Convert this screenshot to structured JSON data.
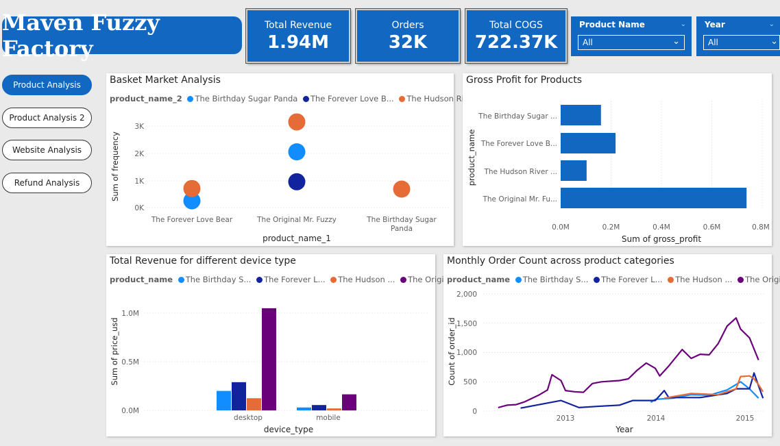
{
  "header": {
    "title": "Maven Fuzzy Factory"
  },
  "kpis": [
    {
      "label": "Total Revenue",
      "value": "1.94M"
    },
    {
      "label": "Orders",
      "value": "32K"
    },
    {
      "label": "Total COGS",
      "value": "722.37K"
    }
  ],
  "slicers": [
    {
      "label": "Product Name",
      "value": "All"
    },
    {
      "label": "Year",
      "value": "All"
    }
  ],
  "nav": [
    "Product Analysis",
    "Product Analysis 2",
    "Website Analysis",
    "Refund Analysis"
  ],
  "colors": {
    "blue_light": "#118dff",
    "blue_dark": "#12239e",
    "orange": "#e66c37",
    "purple": "#6b007b",
    "brand": "#1267c1"
  },
  "charts": {
    "basket": {
      "title": "Basket Market Analysis",
      "legend_title": "product_name_2",
      "legend": [
        "The Birthday Sugar Panda",
        "The Forever Love B...",
        "The Hudson River ..."
      ],
      "xlabel": "product_name_1",
      "ylabel": "Sum of frequency",
      "yticks": [
        "0K",
        "1K",
        "2K",
        "3K"
      ],
      "xcats": [
        "The Forever Love Bear",
        "The Original Mr. Fuzzy",
        "The Birthday Sugar Panda"
      ]
    },
    "gross": {
      "title": "Gross Profit for Products",
      "ylabel": "product_name",
      "xlabel": "Sum of gross_profit",
      "cats": [
        "The Birthday Sugar ...",
        "The Forever Love B...",
        "The Hudson River ...",
        "The Original Mr. Fu..."
      ],
      "xticks": [
        "0.0M",
        "0.2M",
        "0.4M",
        "0.6M",
        "0.8M"
      ]
    },
    "device": {
      "title": "Total Revenue for different device type",
      "legend_title": "product_name",
      "legend": [
        "The Birthday S...",
        "The Forever L...",
        "The Hudson ...",
        "The Origin..."
      ],
      "ylabel": "Sum of price_usd",
      "xlabel": "device_type",
      "yticks": [
        "0.0M",
        "0.5M",
        "1.0M"
      ],
      "cats": [
        "desktop",
        "mobile"
      ]
    },
    "monthly": {
      "title": "Monthly Order Count across product categories",
      "legend_title": "product_name",
      "legend": [
        "The Birthday S...",
        "The Forever L...",
        "The Hudson ...",
        "The Origi..."
      ],
      "ylabel": "Count of order_id",
      "xlabel": "Year",
      "yticks": [
        "0",
        "500",
        "1,000",
        "1,500",
        "2,000"
      ],
      "xticks": [
        "2013",
        "2014",
        "2015"
      ]
    }
  },
  "chart_data": [
    {
      "type": "scatter",
      "title": "Basket Market Analysis",
      "xlabel": "product_name_1",
      "ylabel": "Sum of frequency",
      "categories": [
        "The Forever Love Bear",
        "The Original Mr. Fuzzy",
        "The Birthday Sugar Panda"
      ],
      "ylim": [
        0,
        3500
      ],
      "series": [
        {
          "name": "The Birthday Sugar Panda",
          "values": [
            250,
            2050,
            null
          ]
        },
        {
          "name": "The Forever Love B...",
          "values": [
            null,
            950,
            null
          ]
        },
        {
          "name": "The Hudson River ...",
          "values": [
            700,
            3150,
            680
          ]
        }
      ]
    },
    {
      "type": "bar",
      "title": "Gross Profit for Products",
      "xlabel": "Sum of gross_profit",
      "ylabel": "product_name",
      "categories": [
        "The Birthday Sugar ...",
        "The Forever Love B...",
        "The Hudson River ...",
        "The Original Mr. Fu..."
      ],
      "values": [
        160000,
        218000,
        103000,
        738000
      ],
      "xlim": [
        0,
        800000
      ]
    },
    {
      "type": "bar",
      "title": "Total Revenue for different device type",
      "xlabel": "device_type",
      "ylabel": "Sum of price_usd",
      "categories": [
        "desktop",
        "mobile"
      ],
      "ylim": [
        0,
        1200000
      ],
      "series": [
        {
          "name": "The Birthday S...",
          "values": [
            200000,
            30000
          ]
        },
        {
          "name": "The Forever L...",
          "values": [
            290000,
            55000
          ]
        },
        {
          "name": "The Hudson ...",
          "values": [
            125000,
            20000
          ]
        },
        {
          "name": "The Origin...",
          "values": [
            1050000,
            165000
          ]
        }
      ]
    },
    {
      "type": "line",
      "title": "Monthly Order Count across product categories",
      "xlabel": "Year",
      "ylabel": "Count of order_id",
      "ylim": [
        0,
        2000
      ],
      "series": [
        {
          "name": "The Birthday S...",
          "points": [
            [
              2013.95,
              150
            ],
            [
              2014.0,
              200
            ],
            [
              2014.2,
              220
            ],
            [
              2014.4,
              280
            ],
            [
              2014.6,
              270
            ],
            [
              2014.8,
              360
            ],
            [
              2014.95,
              500
            ],
            [
              2015.05,
              380
            ],
            [
              2015.15,
              220
            ]
          ]
        },
        {
          "name": "The Forever L...",
          "points": [
            [
              2012.5,
              50
            ],
            [
              2012.95,
              180
            ],
            [
              2013.15,
              60
            ],
            [
              2013.35,
              80
            ],
            [
              2013.6,
              100
            ],
            [
              2013.75,
              180
            ],
            [
              2014.0,
              180
            ],
            [
              2014.1,
              350
            ],
            [
              2014.15,
              230
            ],
            [
              2014.5,
              230
            ],
            [
              2014.8,
              300
            ],
            [
              2014.9,
              380
            ],
            [
              2015.05,
              380
            ],
            [
              2015.1,
              650
            ],
            [
              2015.15,
              430
            ],
            [
              2015.2,
              220
            ]
          ]
        },
        {
          "name": "The Hudson ...",
          "points": [
            [
              2014.1,
              220
            ],
            [
              2014.4,
              300
            ],
            [
              2014.7,
              280
            ],
            [
              2014.9,
              380
            ],
            [
              2014.95,
              590
            ],
            [
              2015.05,
              600
            ],
            [
              2015.1,
              550
            ],
            [
              2015.15,
              450
            ],
            [
              2015.2,
              330
            ]
          ]
        },
        {
          "name": "The Origi...",
          "points": [
            [
              2012.25,
              60
            ],
            [
              2012.35,
              100
            ],
            [
              2012.45,
              110
            ],
            [
              2012.55,
              160
            ],
            [
              2012.7,
              270
            ],
            [
              2012.8,
              360
            ],
            [
              2012.85,
              620
            ],
            [
              2012.95,
              520
            ],
            [
              2013.0,
              350
            ],
            [
              2013.1,
              330
            ],
            [
              2013.2,
              320
            ],
            [
              2013.3,
              470
            ],
            [
              2013.4,
              500
            ],
            [
              2013.5,
              510
            ],
            [
              2013.6,
              520
            ],
            [
              2013.7,
              550
            ],
            [
              2013.8,
              700
            ],
            [
              2013.9,
              820
            ],
            [
              2014.0,
              730
            ],
            [
              2014.05,
              600
            ],
            [
              2014.15,
              770
            ],
            [
              2014.3,
              1050
            ],
            [
              2014.4,
              900
            ],
            [
              2014.5,
              970
            ],
            [
              2014.6,
              960
            ],
            [
              2014.7,
              1150
            ],
            [
              2014.8,
              1450
            ],
            [
              2014.9,
              1590
            ],
            [
              2014.95,
              1400
            ],
            [
              2015.05,
              1250
            ],
            [
              2015.15,
              870
            ]
          ]
        }
      ]
    }
  ]
}
